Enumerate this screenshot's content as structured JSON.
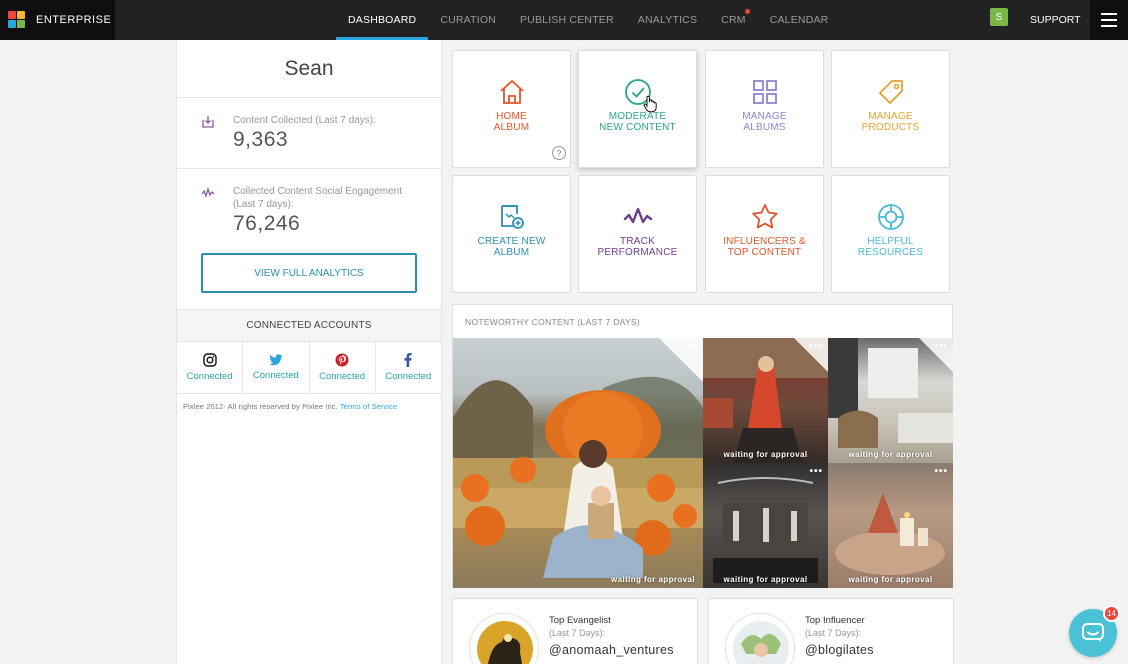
{
  "app": {
    "name": "ENTERPRISE",
    "user_initial": "S",
    "support_label": "SUPPORT"
  },
  "nav": [
    {
      "label": "DASHBOARD",
      "active": true
    },
    {
      "label": "CURATION",
      "active": false
    },
    {
      "label": "PUBLISH CENTER",
      "active": false
    },
    {
      "label": "ANALYTICS",
      "active": false
    },
    {
      "label": "CRM",
      "active": false,
      "notification": true
    },
    {
      "label": "CALENDAR",
      "active": false
    }
  ],
  "left": {
    "user_name": "Sean",
    "stats": [
      {
        "label": "Content Collected (Last 7 days):",
        "value": "9,363",
        "icon": "download-icon"
      },
      {
        "label": "Collected Content Social Engagement (Last 7 days):",
        "value": "76,246",
        "icon": "activity-icon"
      }
    ],
    "analytics_button": "VIEW FULL ANALYTICS",
    "connected_header": "CONNECTED ACCOUNTS",
    "accounts": [
      {
        "network": "instagram",
        "status": "Connected",
        "icon": "instagram-icon"
      },
      {
        "network": "twitter",
        "status": "Connected",
        "icon": "twitter-icon"
      },
      {
        "network": "pinterest",
        "status": "Connected",
        "icon": "pinterest-icon"
      },
      {
        "network": "facebook",
        "status": "Connected",
        "icon": "facebook-icon"
      }
    ],
    "copyright": "Pixlee 2012- All rights reserved by Pixlee Inc.",
    "terms_link": "Terms of Service"
  },
  "tiles": [
    {
      "line1": "HOME",
      "line2": "ALBUM",
      "color": "#e2552a",
      "icon": "house-icon"
    },
    {
      "line1": "MODERATE",
      "line2": "NEW CONTENT",
      "color": "#2aa97f",
      "icon": "check-circle-icon"
    },
    {
      "line1": "MANAGE",
      "line2": "ALBUMS",
      "color": "#8a86d4",
      "icon": "grid-icon"
    },
    {
      "line1": "MANAGE",
      "line2": "PRODUCTS",
      "color": "#e8a12d",
      "icon": "tag-icon"
    },
    {
      "line1": "CREATE NEW",
      "line2": "ALBUM",
      "color": "#2a8fb8",
      "icon": "new-album-icon"
    },
    {
      "line1": "TRACK",
      "line2": "PERFORMANCE",
      "color": "#6b3f8e",
      "icon": "pulse-icon"
    },
    {
      "line1": "INFLUENCERS &",
      "line2": "TOP CONTENT",
      "color": "#e2552a",
      "icon": "star-icon"
    },
    {
      "line1": "HELPFUL",
      "line2": "RESOURCES",
      "color": "#4ab9d3",
      "icon": "lifebuoy-icon"
    }
  ],
  "help_mark": "?",
  "noteworthy": {
    "title": "NOTEWORTHY CONTENT (LAST 7 DAYS)",
    "more_glyph": "•••",
    "status": "waiting for approval"
  },
  "cards": [
    {
      "title": "Top Evangelist",
      "subtitle": "(Last 7 Days):",
      "handle": "@anomaah_ventures"
    },
    {
      "title": "Top Influencer",
      "subtitle": "(Last 7 Days):",
      "handle": "@blogilates"
    }
  ],
  "chat": {
    "badge": "14"
  },
  "colors": {
    "accent": "#2aa6dd",
    "topbar": "#222222",
    "teal": "#2a8fa8"
  }
}
